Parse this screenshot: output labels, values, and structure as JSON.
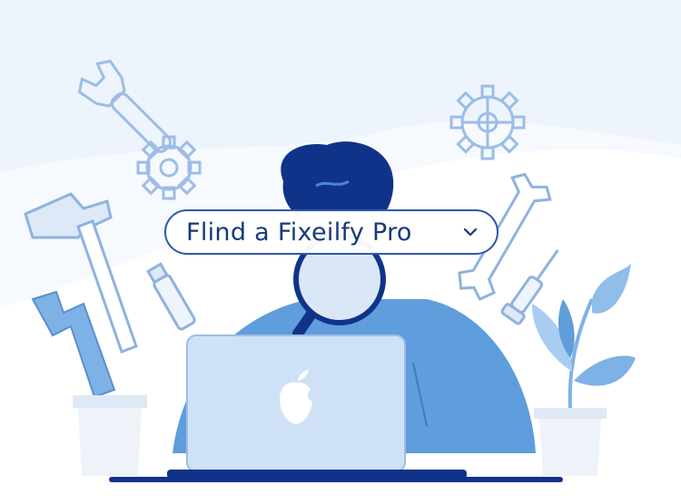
{
  "search": {
    "label": "Flind a Fixeilfy Pro",
    "dropdown_icon": "chevron-down-icon"
  },
  "palette": {
    "navy": "#10338a",
    "primary_blue": "#5f9ddc",
    "light_blue": "#bcd6f2",
    "background": "#f6f9fd",
    "outline_blue": "#8fb2df"
  },
  "icons": [
    "wrench-icon",
    "gear-icon",
    "hammer-icon",
    "screwdriver-icon",
    "adjustable-wrench-icon",
    "plant-icon",
    "laptop-icon",
    "apple-logo-icon",
    "magnifying-glass-icon"
  ]
}
